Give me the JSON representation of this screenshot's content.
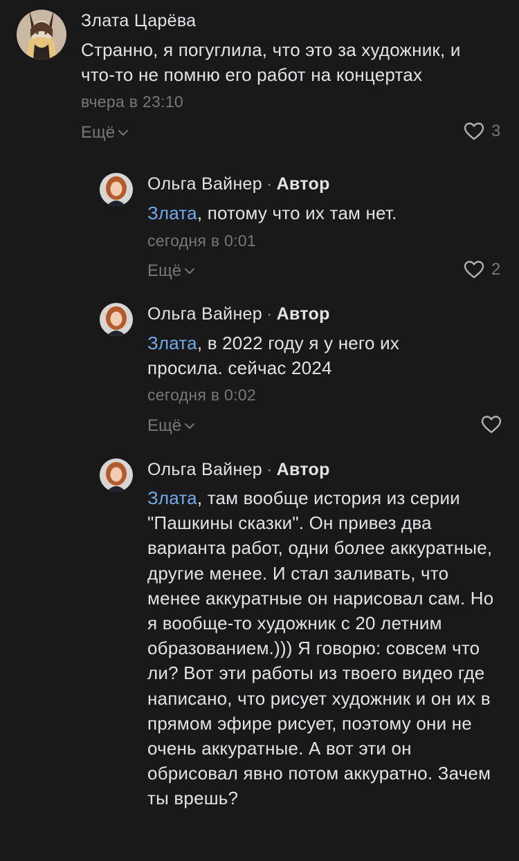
{
  "comments": [
    {
      "author": "Злата Царёва",
      "role": "",
      "mention": "",
      "text": "Странно, я погуглила, что это за художник, и что-то не помню его работ на концертах",
      "time": "вчера в 23:10",
      "more_label": "Ещё",
      "likes": "3"
    },
    {
      "author": "Ольга Вайнер",
      "separator": "·",
      "role": "Автор",
      "mention": "Злата",
      "text": ", потому что их там нет.",
      "time": "сегодня в 0:01",
      "more_label": "Ещё",
      "likes": "2"
    },
    {
      "author": "Ольга Вайнер",
      "separator": "·",
      "role": "Автор",
      "mention": "Злата",
      "text": ", в 2022 году я у него их просила. сейчас 2024",
      "time": "сегодня в 0:02",
      "more_label": "Ещё",
      "likes": ""
    },
    {
      "author": "Ольга Вайнер",
      "separator": "·",
      "role": "Автор",
      "mention": "Злата",
      "text": ", там вообще история из серии \"Пашкины сказки\". Он привез два варианта работ, одни более аккуратные, другие менее. И стал заливать, что менее аккуратные он нарисовал сам. Но я вообще-то художник с 20 летним образованием.))) Я говорю: совсем что ли? Вот эти работы из твоего видео где написано, что рисует художник и он их в прямом эфире рисует, поэтому они не очень аккуратные. А вот эти он обрисовал явно потом аккуратно. Зачем ты врешь?"
    }
  ],
  "colors": {
    "background": "#19191a",
    "text": "#e1e3e6",
    "secondary": "#76787a",
    "mention": "#71aaeb"
  }
}
